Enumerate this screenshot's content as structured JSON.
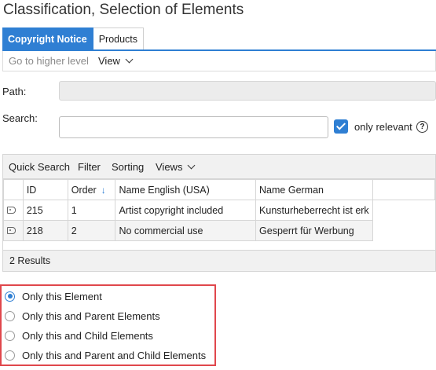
{
  "window": {
    "title": "Classification, Selection of Elements"
  },
  "tabs": [
    {
      "label": "Copyright Notice",
      "active": true
    },
    {
      "label": "Products",
      "active": false
    }
  ],
  "toolbar": {
    "higher_level": "Go to higher level",
    "view": "View"
  },
  "form": {
    "path_label": "Path:",
    "path_value": "",
    "search_label": "Search:",
    "search_value": "",
    "only_relevant_label": "only relevant",
    "only_relevant_checked": true
  },
  "grid": {
    "toolbar": {
      "quick_search": "Quick Search",
      "filter": "Filter",
      "sorting": "Sorting",
      "views": "Views"
    },
    "columns": [
      "ID",
      "Order",
      "Name English (USA)",
      "Name German"
    ],
    "sort_column": "Order",
    "rows": [
      {
        "id": "215",
        "order": "1",
        "name_en": "Artist copyright included",
        "name_de": "Kunsturheberrecht ist erk"
      },
      {
        "id": "218",
        "order": "2",
        "name_en": "No commercial use",
        "name_de": "Gesperrt für Werbung"
      }
    ],
    "results": "2 Results"
  },
  "options": {
    "selected_index": 0,
    "items": [
      "Only this Element",
      "Only this and Parent Elements",
      "Only this and Child Elements",
      "Only this and Parent and Child Elements"
    ]
  },
  "colors": {
    "accent": "#2f7fd3",
    "highlight_border": "#e0474c"
  }
}
